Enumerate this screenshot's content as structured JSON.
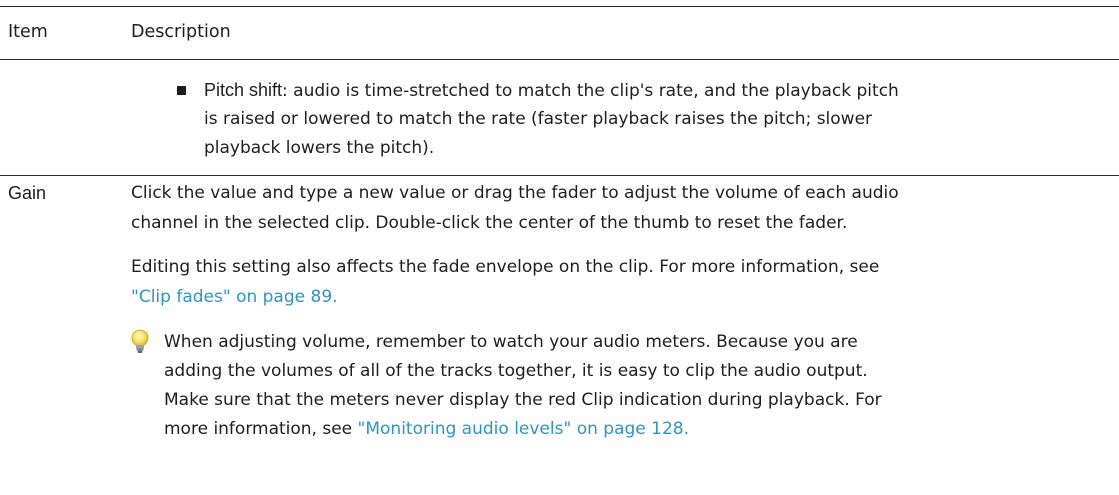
{
  "table": {
    "header": {
      "item": "Item",
      "description": "Description"
    },
    "pitch_row": {
      "term": "Pitch shift",
      "line1": ": audio is time-stretched to match the clip's rate, and the playback pitch",
      "line2": "is raised or lowered to match the rate (faster playback raises the pitch; slower",
      "line3": "playback lowers the pitch)."
    },
    "gain_row": {
      "item": "Gain",
      "p1_line1": "Click the value and type a new value or drag the fader to adjust the volume of each audio",
      "p1_line2": "channel in the selected clip. Double-click the center of the thumb to reset the fader.",
      "p2_line1": "Editing this setting also affects the fade envelope on the clip. For more information, see",
      "p2_link": "\"Clip fades\" on page 89.",
      "tip_line1": "When adjusting volume, remember to watch your audio meters. Because you are",
      "tip_line2": "adding the volumes of all of the tracks together, it is easy to clip the audio output.",
      "tip_line3": "Make sure that the meters never display the red Clip indication during playback. For",
      "tip_text4": "more information, see ",
      "tip_link": "\"Monitoring audio levels\" on page 128."
    }
  },
  "icons": {
    "tip": "lightbulb-icon",
    "bullet": "square-bullet-icon"
  },
  "colors": {
    "link": "#2a96c8",
    "text": "#1e1e1e",
    "rule": "#2a2a2a"
  }
}
